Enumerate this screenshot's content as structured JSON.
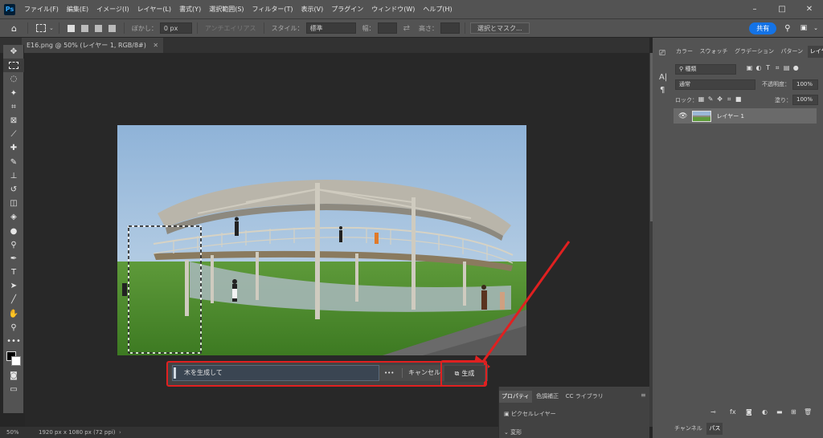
{
  "app": {
    "logo": "Ps"
  },
  "menubar": {
    "items": [
      "ファイル(F)",
      "編集(E)",
      "イメージ(I)",
      "レイヤー(L)",
      "書式(Y)",
      "選択範囲(S)",
      "フィルター(T)",
      "表示(V)",
      "プラグイン",
      "ウィンドウ(W)",
      "ヘルプ(H)"
    ],
    "minimize": "–",
    "maximize": "□",
    "close": "✕"
  },
  "options": {
    "feather_label": "ぼかし：",
    "feather_value": "0 px",
    "antialias": "アンチエイリアス",
    "style_label": "スタイル：",
    "style_value": "標準",
    "width_label": "幅：",
    "height_label": "高さ：",
    "select_mask": "選択とマスク...",
    "share": "共有"
  },
  "document": {
    "tab_title": "E16.png @ 50% (レイヤー 1, RGB/8#)",
    "tab_close": "✕"
  },
  "generative_bar": {
    "prompt_value": "木を生成して",
    "more": "•••",
    "cancel": "キャンセル",
    "generate": "生成"
  },
  "status": {
    "zoom": "50%",
    "size": "1920 px x 1080 px (72 ppi)"
  },
  "layers_panel": {
    "tabs": [
      "カラー",
      "スウォッチ",
      "グラデーション",
      "パターン",
      "レイヤー"
    ],
    "active_tab": "レイヤー",
    "filter_kind": "種類",
    "blend_mode": "通常",
    "opacity_label": "不透明度：",
    "opacity_value": "100%",
    "lock_label": "ロック：",
    "fill_label": "塗り：",
    "fill_value": "100%",
    "layers": [
      {
        "name": "レイヤー 1",
        "visible": true
      }
    ],
    "bottom_tabs": [
      "チャンネル",
      "パス"
    ]
  },
  "properties_panel": {
    "tabs": [
      "プロパティ",
      "色調補正",
      "CC ライブラリ"
    ],
    "active_tab": "プロパティ",
    "layer_type": "ピクセルレイヤー",
    "section": "変形"
  },
  "colors": {
    "accent": "#1473e6",
    "highlight": "#e02020",
    "ui_bg": "#535353",
    "canvas_bg": "#282828"
  }
}
